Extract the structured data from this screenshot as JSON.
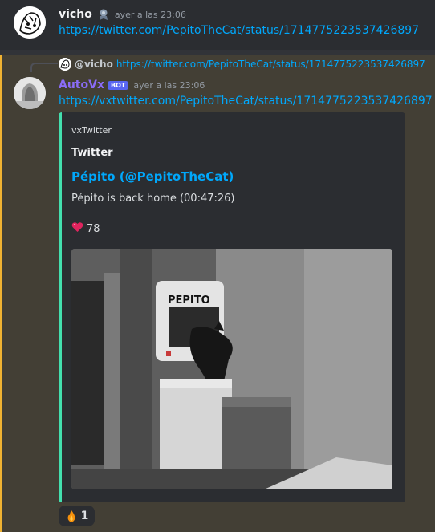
{
  "message1": {
    "username": "vicho",
    "role_icon": "medal-icon",
    "timestamp": "ayer a las 23:06",
    "link": "https://twitter.com/PepitoTheCat/status/1714775223537426897"
  },
  "message2": {
    "reply": {
      "username": "@vicho",
      "link": "https://twitter.com/PepitoTheCat/status/1714775223537426897"
    },
    "username": "AutoVx",
    "badge": "BOT",
    "timestamp": "ayer a las 23:06",
    "link": "https://vxtwitter.com/PepitoTheCat/status/1714775223537426897",
    "embed": {
      "provider": "vxTwitter",
      "author": "Twitter",
      "title": "Pépito (@PepitoTheCat)",
      "description": "Pépito is back home (00:47:26)",
      "likes_icon": "heart-icon",
      "likes": "78",
      "image_sign": "PEPITO",
      "accent_color": "#43dfae"
    },
    "reactions": [
      {
        "icon": "fire-icon",
        "count": "1"
      }
    ]
  }
}
